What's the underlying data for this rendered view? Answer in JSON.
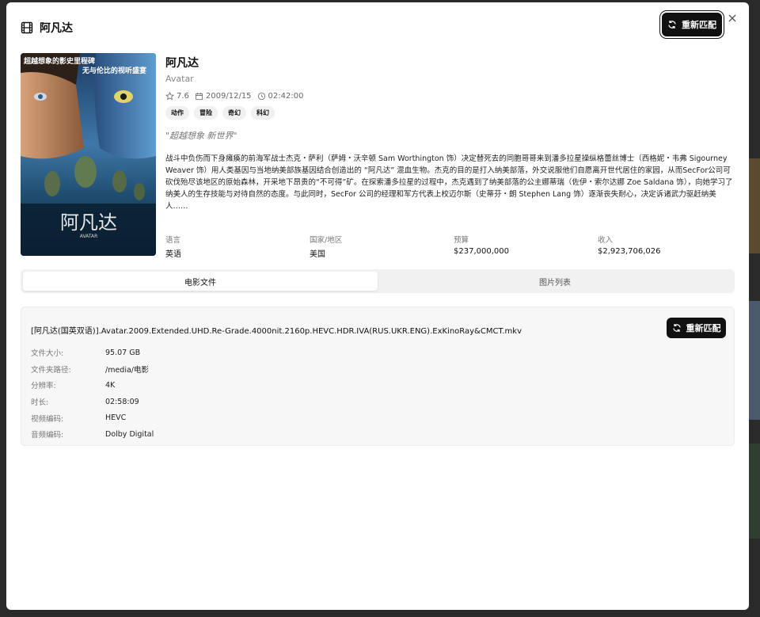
{
  "header": {
    "title": "阿凡达",
    "rematch_label": "重新匹配"
  },
  "movie": {
    "title_cn": "阿凡达",
    "title_en": "Avatar",
    "rating": "7.6",
    "release_date": "2009/12/15",
    "runtime": "02:42:00",
    "genres": [
      "动作",
      "冒险",
      "奇幻",
      "科幻"
    ],
    "tagline": "\"超越想象 新世界\"",
    "overview": "战斗中负伤而下身瘫痪的前海军战士杰克・萨利（萨姆・沃辛顿 Sam Worthington 饰）决定替死去的同胞哥哥来到潘多拉星操纵格蕾丝博士（西格妮・韦弗 Sigourney Weaver 饰）用人类基因与当地纳美部族基因结合创造出的 “阿凡达” 混血生物。杰克的目的是打入纳美部落，外交说服他们自愿离开世代居住的家园，从而SecFor公司可砍伐殆尽该地区的原始森林，开采地下昂贵的“不可得”矿。在探索潘多拉星的过程中，杰克遇到了纳美部落的公主娜蒂瑞（佐伊・索尔达娜 Zoe Saldana 饰），向她学习了纳美人的生存技能与对待自然的态度。与此同时，SecFor 公司的经理和军方代表上校迈尔斯（史蒂芬・朗 Stephen Lang 饰）逐渐丧失耐心，决定诉诸武力驱赶纳美人……"
  },
  "poster": {
    "line1": "超越想象的影史里程碑",
    "line2": "无与伦比的视听盛宴",
    "title_cn": "阿凡达",
    "title_en": "AVATAR"
  },
  "stats": [
    {
      "label": "语言",
      "value": "英语"
    },
    {
      "label": "国家/地区",
      "value": "美国"
    },
    {
      "label": "预算",
      "value": "$237,000,000"
    },
    {
      "label": "收入",
      "value": "$2,923,706,026"
    }
  ],
  "tabs": [
    {
      "label": "电影文件",
      "active": true
    },
    {
      "label": "图片列表",
      "active": false
    }
  ],
  "file": {
    "name": "[阿凡达(国英双语)].Avatar.2009.Extended.UHD.Re-Grade.4000nit.2160p.HEVC.HDR.IVA(RUS.UKR.ENG).ExKinoRay&CMCT.mkv",
    "rematch_label": "重新匹配",
    "rows": [
      {
        "label": "文件大小:",
        "value": "95.07 GB"
      },
      {
        "label": "文件夹路径:",
        "value": "/media/电影"
      },
      {
        "label": "分辨率:",
        "value": "4K"
      },
      {
        "label": "时长:",
        "value": "02:58:09"
      },
      {
        "label": "视频编码:",
        "value": "HEVC"
      },
      {
        "label": "音频编码:",
        "value": "Dolby Digital"
      }
    ]
  },
  "colors": {
    "primary_button": "#111111",
    "tab_bg": "#f1f1f1",
    "card_bg": "#f7f7f7"
  },
  "icons": [
    "film-icon",
    "refresh-icon",
    "close-icon",
    "star-icon",
    "calendar-icon",
    "clock-icon"
  ]
}
